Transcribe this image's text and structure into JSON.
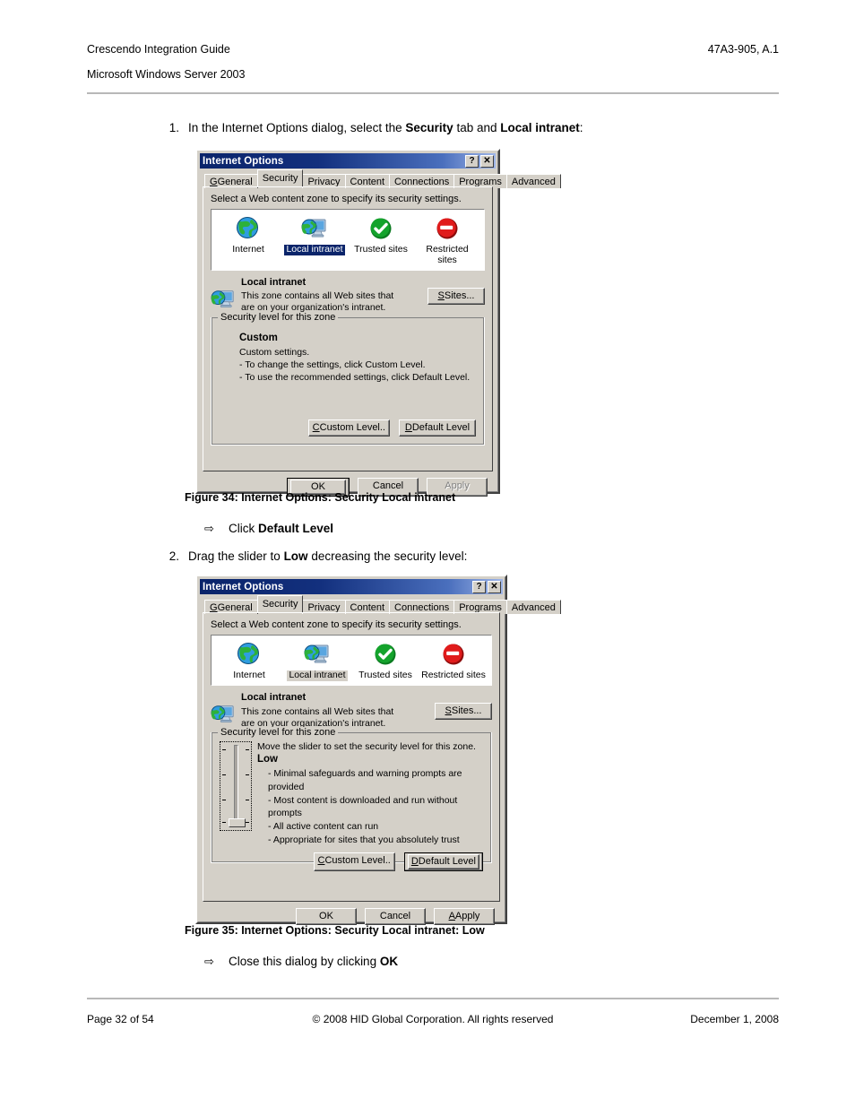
{
  "header": {
    "left_line1": "Crescendo Integration Guide",
    "right_line1": "47A3-905, A.1",
    "left_line2": "Microsoft Windows Server 2003"
  },
  "footer": {
    "page": "Page 32 of 54",
    "copyright": "© 2008 HID Global Corporation.  All rights reserved",
    "date": "December 1, 2008"
  },
  "steps": {
    "step1_num": "1.",
    "step1_pre": "In the Internet Options dialog, select the ",
    "step1_b1": "Security",
    "step1_mid": " tab and ",
    "step1_b2": "Local intranet",
    "step1_post": ":",
    "arrow1_glyph": "⇨",
    "arrow1_pre": "Click ",
    "arrow1_b": "Default Level",
    "step2_num": "2.",
    "step2_pre": "Drag the slider to ",
    "step2_b": "Low",
    "step2_post": " decreasing the security level:",
    "arrow2_glyph": "⇨",
    "arrow2_pre": "Close this dialog by clicking ",
    "arrow2_b": "OK"
  },
  "captions": {
    "fig34": "Figure 34: Internet Options: Security Local intranet",
    "fig35": "Figure 35: Internet Options: Security Local intranet: Low"
  },
  "dialog": {
    "title": "Internet Options",
    "help_btn": "?",
    "close_btn": "✕",
    "tabs": [
      {
        "label": "General",
        "mnemonic": "G"
      },
      {
        "label": "Security",
        "mnemonic": "S"
      },
      {
        "label": "Privacy",
        "mnemonic": "P"
      },
      {
        "label": "Content",
        "mnemonic": "C"
      },
      {
        "label": "Connections",
        "mnemonic": "n"
      },
      {
        "label": "Programs",
        "mnemonic": "r"
      },
      {
        "label": "Advanced",
        "mnemonic": "A"
      }
    ],
    "active_tab": "Security",
    "zone_hint": "Select a Web content zone to specify its security settings.",
    "zones": [
      {
        "label": "Internet",
        "icon": "globe-icon"
      },
      {
        "label": "Local intranet",
        "icon": "globe-monitor-icon"
      },
      {
        "label": "Trusted sites",
        "icon": "green-check-icon"
      },
      {
        "label": "Restricted sites",
        "icon": "red-deny-icon"
      }
    ],
    "selected_zone": "Local intranet",
    "zone_desc_title": "Local intranet",
    "zone_desc_line1": "This zone contains all Web sites that",
    "zone_desc_line2": "are on your organization's intranet.",
    "sites_button": "Sites...",
    "group_label": "Security level for this zone",
    "buttons": {
      "custom_level": "Custom Level..",
      "default_level": "Default Level",
      "ok": "OK",
      "cancel": "Cancel",
      "apply": "Apply"
    }
  },
  "dialog1": {
    "level_name": "Custom",
    "level_lines": [
      "Custom settings.",
      "- To change the settings, click Custom Level.",
      "- To use the recommended settings, click Default Level."
    ],
    "apply_enabled": false
  },
  "dialog2": {
    "slider_hint": "Move the slider to set the security level for this zone.",
    "level_name": "Low",
    "bullets": [
      "- Minimal safeguards and warning prompts are provided",
      "- Most content is downloaded and run without prompts",
      "- All active content can run",
      "- Appropriate for sites that you absolutely trust"
    ],
    "apply_enabled": true
  }
}
